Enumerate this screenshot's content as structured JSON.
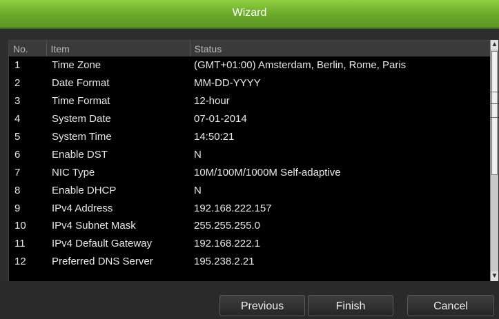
{
  "window": {
    "title": "Wizard"
  },
  "table": {
    "headers": {
      "no": "No.",
      "item": "Item",
      "status": "Status"
    },
    "rows": [
      {
        "no": "1",
        "item": "Time Zone",
        "status": "(GMT+01:00) Amsterdam, Berlin, Rome, Paris"
      },
      {
        "no": "2",
        "item": "Date Format",
        "status": "MM-DD-YYYY"
      },
      {
        "no": "3",
        "item": "Time Format",
        "status": "12-hour"
      },
      {
        "no": "4",
        "item": "System Date",
        "status": "07-01-2014"
      },
      {
        "no": "5",
        "item": "System Time",
        "status": "14:50:21"
      },
      {
        "no": "6",
        "item": "Enable DST",
        "status": "N"
      },
      {
        "no": "7",
        "item": "NIC Type",
        "status": "10M/100M/1000M Self-adaptive"
      },
      {
        "no": "8",
        "item": "Enable DHCP",
        "status": "N"
      },
      {
        "no": "9",
        "item": "IPv4 Address",
        "status": "192.168.222.157"
      },
      {
        "no": "10",
        "item": "IPv4 Subnet Mask",
        "status": "255.255.255.0"
      },
      {
        "no": "11",
        "item": "IPv4 Default Gateway",
        "status": "192.168.222.1"
      },
      {
        "no": "12",
        "item": "Preferred DNS Server",
        "status": "195.238.2.21"
      }
    ]
  },
  "buttons": {
    "previous": "Previous",
    "finish": "Finish",
    "cancel": "Cancel"
  },
  "icons": {
    "scroll_up": "chevron-up-icon",
    "scroll_down": "chevron-down-icon"
  },
  "colors": {
    "title_bar": "#6aa82a",
    "background": "#2d2d2d",
    "table_bg": "#000000"
  }
}
